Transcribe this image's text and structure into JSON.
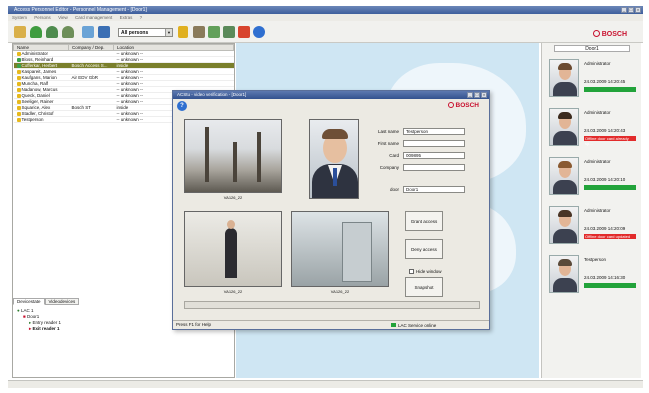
{
  "app": {
    "title": "Access Personnel Editor - Personnel Management - [Door1]"
  },
  "menu": [
    "System",
    "Persons",
    "View",
    "Card management",
    "Extras",
    "?"
  ],
  "toolbar": {
    "filter_value": "All persons",
    "colors": {
      "accent": "#c8102e"
    }
  },
  "brand": "BOSCH",
  "persons_table": {
    "headers": [
      "Name",
      "Company / Dep.",
      "Location"
    ],
    "rows": [
      {
        "name": "Administrator",
        "company": "",
        "location": "-- unknown --",
        "status": "yellow"
      },
      {
        "name": "Bloss, Reinhard",
        "company": "",
        "location": "-- unknown --",
        "status": "green"
      },
      {
        "name": "Cofferkar, Herbert",
        "company": "Bosch Access S...",
        "location": "inside",
        "status": "green",
        "selected": true
      },
      {
        "name": "Kaspareit, James",
        "company": "",
        "location": "-- unknown --",
        "status": "yellow"
      },
      {
        "name": "Kaufgans, Marion",
        "company": "Air EDV GbR",
        "location": "-- unknown --",
        "status": "yellow"
      },
      {
        "name": "Muncha, Ralf",
        "company": "",
        "location": "-- unknown --",
        "status": "yellow"
      },
      {
        "name": "Nadanow, Marcus",
        "company": "",
        "location": "-- unknown --",
        "status": "yellow"
      },
      {
        "name": "Queck, Daniel",
        "company": "",
        "location": "-- unknown --",
        "status": "yellow"
      },
      {
        "name": "Seeliger, Rainer",
        "company": "",
        "location": "-- unknown --",
        "status": "yellow"
      },
      {
        "name": "Squarice, Alex",
        "company": "Bosch ST",
        "location": "inside",
        "status": "yellow"
      },
      {
        "name": "Stadler, Christof",
        "company": "",
        "location": "-- unknown --",
        "status": "yellow"
      },
      {
        "name": "Testperson",
        "company": "",
        "location": "-- unknown --",
        "status": "yellow"
      }
    ]
  },
  "left_tabs": [
    "Devicestate",
    "Videodevices"
  ],
  "device_tree": {
    "root": "LAC 1",
    "door": "Door1",
    "entry": "Entry reader 1",
    "exit": "Exit reader 1"
  },
  "dialog": {
    "title": "ACStu - video verification - [Door1]",
    "cam_labels": [
      "VA126_22",
      "VA126_22",
      "VA126_22"
    ],
    "fields": [
      {
        "label": "Last name",
        "value": "Testperson"
      },
      {
        "label": "First name",
        "value": ""
      },
      {
        "label": "Card",
        "value": "009895"
      },
      {
        "label": "Company",
        "value": ""
      },
      {
        "label": "door",
        "value": "Door1"
      }
    ],
    "buttons": {
      "grant": "Grant access",
      "deny": "Deny access",
      "snapshot": "Snapshot"
    },
    "hide_window_label": "Hide window",
    "status_help": "Press F1 for Help",
    "status_lac": "LAC Service online"
  },
  "right_panel": {
    "header": "Door1",
    "events": [
      {
        "label": "Administrator",
        "time": "24.03.2009 14:20:45",
        "status": "",
        "status_color": "#22a33a"
      },
      {
        "label": "Administrator",
        "time": "24.03.2009 14:20:43",
        "status": "Offline door card already sp...",
        "status_color": "#e22b2b"
      },
      {
        "label": "Administrator",
        "time": "24.03.2009 14:20:10",
        "status": "",
        "status_color": "#22a33a"
      },
      {
        "label": "Administrator",
        "time": "24.03.2009 14:20:09",
        "status": "Offline door card updated",
        "status_color": "#e22b2b"
      },
      {
        "label": "Testperson",
        "time": "24.03.2009 14:16:30",
        "status": "",
        "status_color": "#22a33a"
      }
    ]
  }
}
